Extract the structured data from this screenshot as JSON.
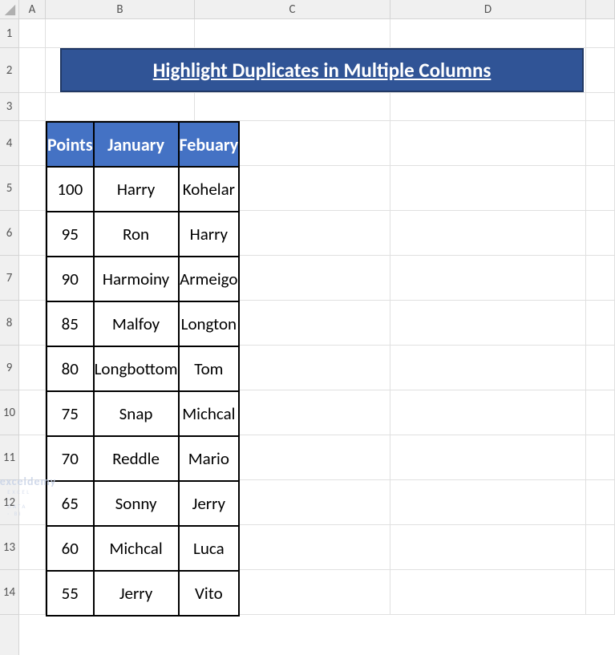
{
  "columns": {
    "A": "A",
    "B": "B",
    "C": "C",
    "D": "D"
  },
  "rows": {
    "r1": "1",
    "r2": "2",
    "r3": "3",
    "r4": "4",
    "r5": "5",
    "r6": "6",
    "r7": "7",
    "r8": "8",
    "r9": "9",
    "r10": "10",
    "r11": "11",
    "r12": "12",
    "r13": "13",
    "r14": "14"
  },
  "title": "Highlight Duplicates in Multiple Columns",
  "headers": {
    "points": "Points",
    "january": "January",
    "febuary": "Febuary"
  },
  "data": [
    {
      "points": "100",
      "jan": "Harry",
      "feb": "Kohelar"
    },
    {
      "points": "95",
      "jan": "Ron",
      "feb": "Harry"
    },
    {
      "points": "90",
      "jan": "Harmoiny",
      "feb": "Armeigo"
    },
    {
      "points": "85",
      "jan": "Malfoy",
      "feb": "Longton"
    },
    {
      "points": "80",
      "jan": "Longbottom",
      "feb": "Tom"
    },
    {
      "points": "75",
      "jan": "Snap",
      "feb": "Michcal"
    },
    {
      "points": "70",
      "jan": "Reddle",
      "feb": "Mario"
    },
    {
      "points": "65",
      "jan": "Sonny",
      "feb": "Jerry"
    },
    {
      "points": "60",
      "jan": "Michcal",
      "feb": "Luca"
    },
    {
      "points": "55",
      "jan": "Jerry",
      "feb": "Vito"
    }
  ],
  "watermark": {
    "main": "exceldemy",
    "sub": "EXCEL · DATA · BI"
  }
}
